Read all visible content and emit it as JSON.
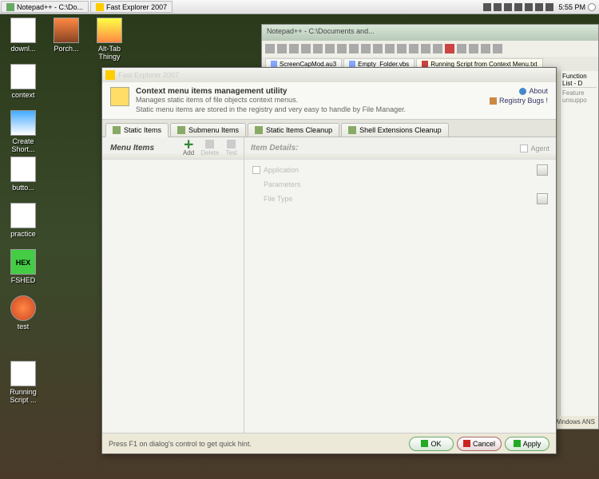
{
  "taskbar": {
    "buttons": [
      {
        "label": "Notepad++ - C:\\Do..."
      },
      {
        "label": "Fast Explorer 2007"
      }
    ],
    "time": "5:55 PM"
  },
  "desktop_icons": [
    {
      "label": "downl..."
    },
    {
      "label": "Porch..."
    },
    {
      "label": "Alt-Tab Thingy"
    },
    {
      "label": "context"
    },
    {
      "label": "Create Short..."
    },
    {
      "label": "butto..."
    },
    {
      "label": "practice"
    },
    {
      "label": "FSHED"
    },
    {
      "label": "test"
    },
    {
      "label": "Running Script ..."
    }
  ],
  "bgwin": {
    "title_faint": "Notepad++ - C:\\Documents and...",
    "tabs": [
      {
        "label": "ScreenCapMod.au3"
      },
      {
        "label": "Empty_Folder.vbs"
      },
      {
        "label": "Running Script from Context Menu.txt"
      }
    ],
    "side": "Function List - D",
    "side2": "Feature unsuppo",
    "status": "Windows   ANS"
  },
  "dialog": {
    "faint_title": "Fast Explorer 2007",
    "header": {
      "title": "Context menu items management utility",
      "desc1": "Manages static items of file objects context menus.",
      "desc2": "Static menu items are stored in the registry and very easy to handle by File Manager.",
      "about": "About",
      "bugs": "Registry Bugs !"
    },
    "tabs": [
      {
        "label": "Static Items"
      },
      {
        "label": "Submenu Items"
      },
      {
        "label": "Static Items Cleanup"
      },
      {
        "label": "Shell Extensions Cleanup"
      }
    ],
    "menu_items": {
      "heading": "Menu Items",
      "actions": {
        "add": "Add",
        "delete": "Delete",
        "test": "Test"
      }
    },
    "details": {
      "heading": "Item Details:",
      "agent": "Agent",
      "rows": {
        "application": "Application",
        "parameters": "Parameters",
        "filetype": "File Type"
      }
    },
    "footer": {
      "hint": "Press F1 on dialog's control to get quick hint.",
      "ok": "OK",
      "cancel": "Cancel",
      "apply": "Apply"
    }
  }
}
